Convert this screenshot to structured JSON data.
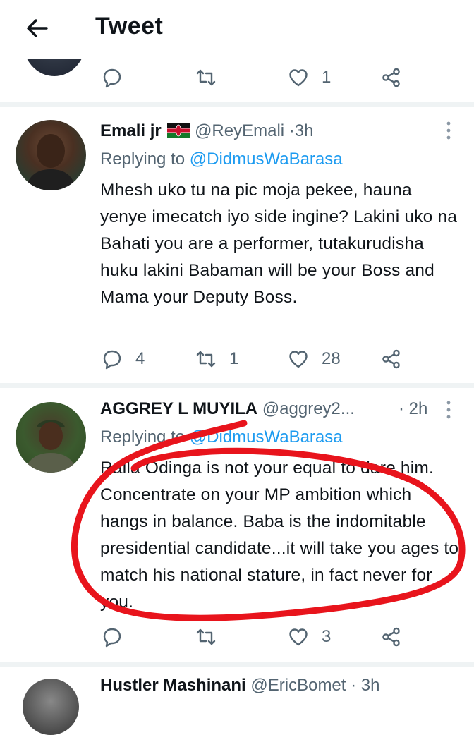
{
  "header": {
    "title": "Tweet"
  },
  "top_tweet": {
    "like_count": "1"
  },
  "tweet1": {
    "name": "Emali jr",
    "handle": "@ReyEmali",
    "time": "3h",
    "replying_prefix": "Replying to ",
    "replying_to": "@DidmusWaBarasa",
    "text": "Mhesh uko tu na pic moja pekee, hauna yenye imecatch iyo side ingine? Lakini uko na Bahati you are a performer, tutakurudisha huku lakini Babaman will be your Boss and Mama your Deputy Boss.",
    "reply_count": "4",
    "retweet_count": "1",
    "like_count": "28"
  },
  "tweet2": {
    "name": "AGGREY L MUYILA",
    "handle": "@aggrey2...",
    "time": "2h",
    "replying_prefix": "Replying to ",
    "replying_to": "@DidmusWaBarasa",
    "text": "Raila Odinga is not your equal to dare him. Concentrate on your MP ambition which hangs in balance. Baba is the indomitable presidential candidate...it will take you ages to match his national stature, in fact never for you.",
    "like_count": "3"
  },
  "tweet3": {
    "name": "Hustler Mashinani",
    "handle": "@EricBomet",
    "time": "3h"
  },
  "colors": {
    "accent": "#1d9bf0",
    "secondary_text": "#536471",
    "annotation": "#e8141c"
  }
}
